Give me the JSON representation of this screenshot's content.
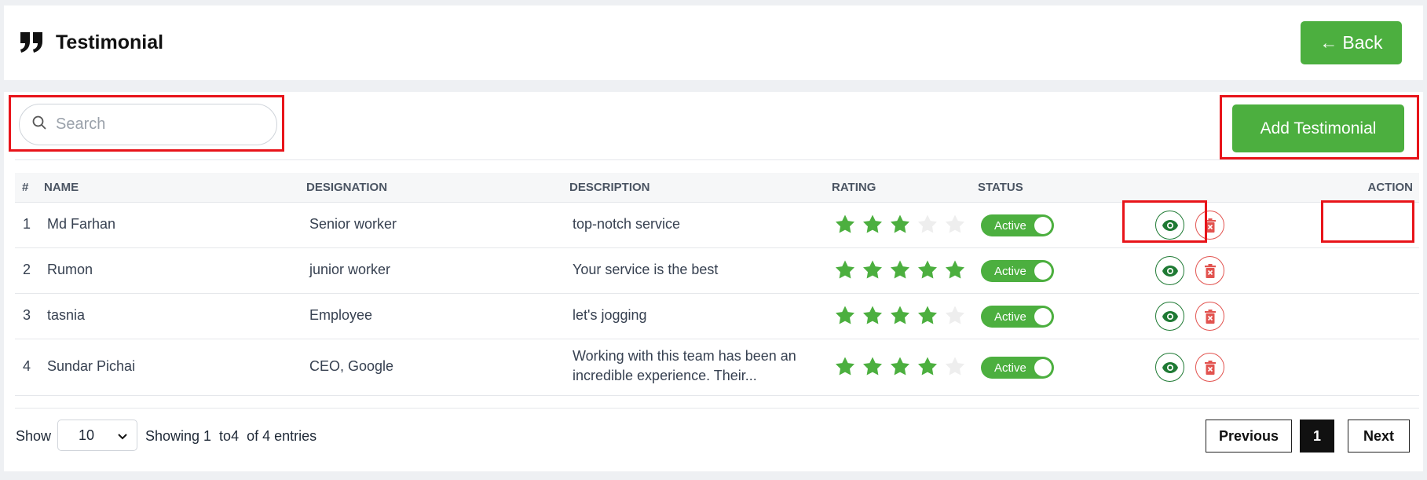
{
  "header": {
    "title": "Testimonial",
    "back_label": "Back",
    "back_arrow": "←"
  },
  "search": {
    "placeholder": "Search",
    "value": ""
  },
  "add_button_label": "Add Testimonial",
  "table": {
    "columns": [
      "#",
      "NAME",
      "DESIGNATION",
      "DESCRIPTION",
      "RATING",
      "STATUS",
      "ACTION"
    ],
    "rows": [
      {
        "index": "1",
        "name": "Md Farhan",
        "designation": "Senior worker",
        "description": "top-notch service",
        "rating": 3,
        "status": "Active"
      },
      {
        "index": "2",
        "name": "Rumon",
        "designation": "junior worker",
        "description": "Your service is the best",
        "rating": 5,
        "status": "Active"
      },
      {
        "index": "3",
        "name": "tasnia",
        "designation": "Employee",
        "description": "let's jogging",
        "rating": 4,
        "status": "Active"
      },
      {
        "index": "4",
        "name": "Sundar Pichai",
        "designation": "CEO, Google",
        "description": "Working with this team has been an incredible experience. Their...",
        "rating": 4,
        "status": "Active"
      }
    ]
  },
  "footer": {
    "show_label": "Show",
    "page_size": "10",
    "entries_text": "Showing 1  to4  of 4 entries",
    "prev_label": "Previous",
    "current_page": "1",
    "next_label": "Next"
  },
  "colors": {
    "accent": "#4caf3f",
    "star_empty": "#eeeeee",
    "view_icon": "#1f7a34",
    "delete_icon": "#e2534f",
    "highlight": "#e8141a"
  },
  "icons": {
    "title": "quote-icon",
    "search": "search-icon",
    "view": "eye-icon",
    "delete": "trash-icon",
    "select": "chevron-down-icon"
  }
}
